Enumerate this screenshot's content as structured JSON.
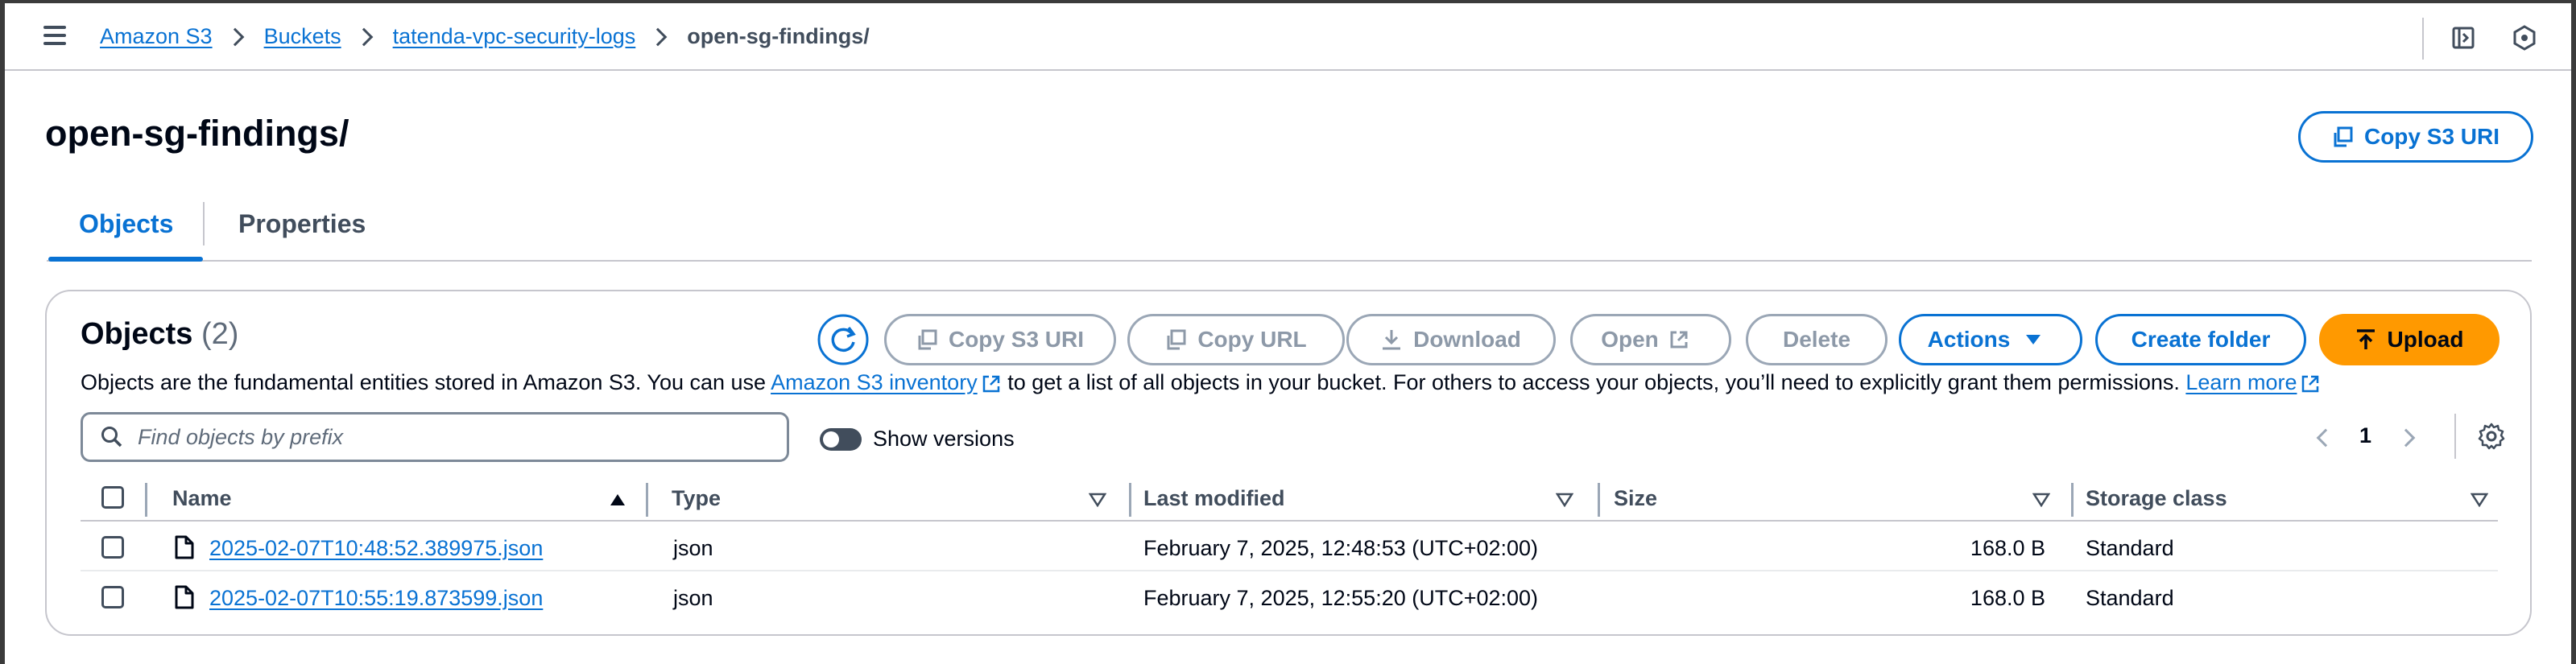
{
  "breadcrumb": {
    "items": [
      "Amazon S3",
      "Buckets",
      "tatenda-vpc-security-logs"
    ],
    "current": "open-sg-findings/"
  },
  "header": {
    "title": "open-sg-findings/",
    "copy_uri_label": "Copy S3 URI"
  },
  "tabs": [
    {
      "label": "Objects",
      "active": true
    },
    {
      "label": "Properties",
      "active": false
    }
  ],
  "objects_panel": {
    "heading": "Objects",
    "count": "(2)",
    "toolbar": {
      "copy_uri": "Copy S3 URI",
      "copy_url": "Copy URL",
      "download": "Download",
      "open": "Open",
      "delete": "Delete",
      "actions": "Actions",
      "create_folder": "Create folder",
      "upload": "Upload"
    },
    "description": {
      "before": "Objects are the fundamental entities stored in Amazon S3. You can use ",
      "inventory_link": "Amazon S3 inventory",
      "middle": " to get a list of all objects in your bucket. For others to access your objects, you’ll need to explicitly grant them permissions. ",
      "learn_more": "Learn more"
    },
    "search": {
      "placeholder": "Find objects by prefix"
    },
    "show_versions_label": "Show versions",
    "show_versions": false,
    "page": "1"
  },
  "table": {
    "columns": [
      "Name",
      "Type",
      "Last modified",
      "Size",
      "Storage class"
    ],
    "rows": [
      {
        "name": "2025-02-07T10:48:52.389975.json",
        "type": "json",
        "last_modified": "February 7, 2025, 12:48:53 (UTC+02:00)",
        "size": "168.0 B",
        "storage_class": "Standard"
      },
      {
        "name": "2025-02-07T10:55:19.873599.json",
        "type": "json",
        "last_modified": "February 7, 2025, 12:55:20 (UTC+02:00)",
        "size": "168.0 B",
        "storage_class": "Standard"
      }
    ]
  },
  "colors": {
    "link": "#0972d3",
    "primary_button": "#ff9900",
    "disabled": "#8d99a8",
    "text": "#000716"
  },
  "icons": [
    "menu-icon",
    "chevron-right-icon",
    "sidebar-toggle-icon",
    "settings-hex-icon",
    "copy-icon",
    "refresh-icon",
    "download-icon",
    "external-link-icon",
    "caret-down-icon",
    "upload-icon",
    "search-icon",
    "file-icon",
    "sort-ascending-icon",
    "sort-descending-icon",
    "gear-icon"
  ]
}
